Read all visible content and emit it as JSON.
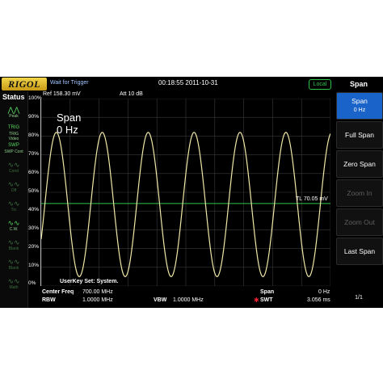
{
  "header": {
    "logo": "RIGOL",
    "trigger_status": "Wait for Trigger",
    "datetime": "00:18:55 2011-10-31",
    "local_badge": "Local"
  },
  "status_panel": {
    "title": "Status",
    "items": [
      {
        "icon": "peak-icon",
        "label": "Peak",
        "glyph": "⋀⋀",
        "active": true
      },
      {
        "icon": "trig-video-icon",
        "label": "TRIG Video",
        "glyph": "TRIG",
        "active": true
      },
      {
        "icon": "sweep-cont-icon",
        "label": "SWP Cont",
        "glyph": "SWP",
        "active": true
      },
      {
        "icon": "cond-icon",
        "label": "Cond",
        "glyph": "∿∿",
        "active": false
      },
      {
        "icon": "off-icon",
        "label": "Off",
        "glyph": "∿∿",
        "active": false
      },
      {
        "icon": "trace-icon",
        "label": "Trc",
        "glyph": "∿∿",
        "active": false
      },
      {
        "icon": "clear-write-icon",
        "label": "C.W.",
        "glyph": "∿∿",
        "active": true
      },
      {
        "icon": "blank-icon",
        "label": "Blank",
        "glyph": "∿∿",
        "active": false
      },
      {
        "icon": "trace-3-icon",
        "label": "Blank",
        "glyph": "∿∿",
        "active": false
      },
      {
        "icon": "math-icon",
        "label": "Math",
        "glyph": "∿∿",
        "active": false
      }
    ]
  },
  "plot": {
    "ref": "Ref  158.30 mV",
    "att": "Att    10 dB",
    "y_labels": [
      "100%",
      "90%",
      "80%",
      "70%",
      "60%",
      "50%",
      "40%",
      "30%",
      "20%",
      "10%",
      "0%"
    ],
    "annotation_line1": "Span",
    "annotation_line2": "0 Hz",
    "tl_label": "TL 70.05 mV",
    "userkey": "UserKey Set:  System."
  },
  "chart_data": {
    "type": "line",
    "series": [
      {
        "values": [
          0.46,
          0.82,
          0.05,
          0.82,
          0.05,
          0.82,
          0.05,
          0.82,
          0.05,
          0.82,
          0.05,
          0.82,
          0.05,
          0.67
        ]
      }
    ],
    "trigger_level_percent": 44,
    "ylim": [
      0,
      100
    ],
    "cycles": 6.3,
    "grid": true
  },
  "footer": {
    "center_freq_label": "Center Freq",
    "center_freq_value": "700.00 MHz",
    "span_label": "Span",
    "span_value": "0 Hz",
    "rbw_label": "RBW",
    "rbw_value": "1.0000 MHz",
    "vbw_label": "VBW",
    "vbw_value": "1.0000 MHz",
    "swt_label": "SWT",
    "swt_value": "3.056 ms"
  },
  "menu": {
    "title": "Span",
    "buttons": [
      {
        "label": "Span",
        "sub": "0 Hz",
        "active": true,
        "enabled": true
      },
      {
        "label": "Full Span",
        "sub": "",
        "active": false,
        "enabled": true
      },
      {
        "label": "Zero Span",
        "sub": "",
        "active": false,
        "enabled": true
      },
      {
        "label": "Zoom In",
        "sub": "",
        "active": false,
        "enabled": false
      },
      {
        "label": "Zoom Out",
        "sub": "",
        "active": false,
        "enabled": false
      },
      {
        "label": "Last Span",
        "sub": "",
        "active": false,
        "enabled": true
      }
    ],
    "page": "1/1"
  },
  "colors": {
    "trace": "#f0e8a8",
    "trigger_line": "#2fc24a",
    "grid": "#3a3a3a",
    "active_button": "#1a63c8"
  }
}
